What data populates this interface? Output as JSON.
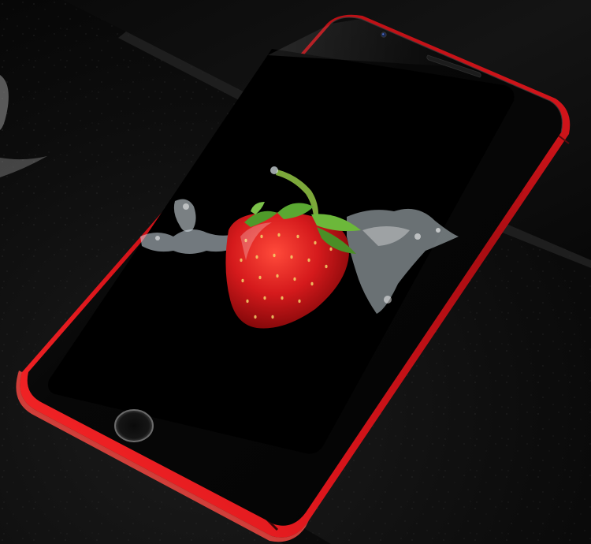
{
  "image": {
    "subject": "phone-product-photo",
    "colors": {
      "background": "#0c0c0c",
      "phone_body": "#d4141a",
      "phone_body_highlight": "#ff3a34",
      "phone_body_shadow": "#7a0a0d",
      "front_glass": "#050505",
      "screen": "#000000",
      "strawberry": "#c8141a",
      "leaf": "#5aa02c",
      "water": "#d8e4ea"
    },
    "icons": [
      "front-camera-icon",
      "earpiece-icon",
      "home-button-icon"
    ]
  }
}
